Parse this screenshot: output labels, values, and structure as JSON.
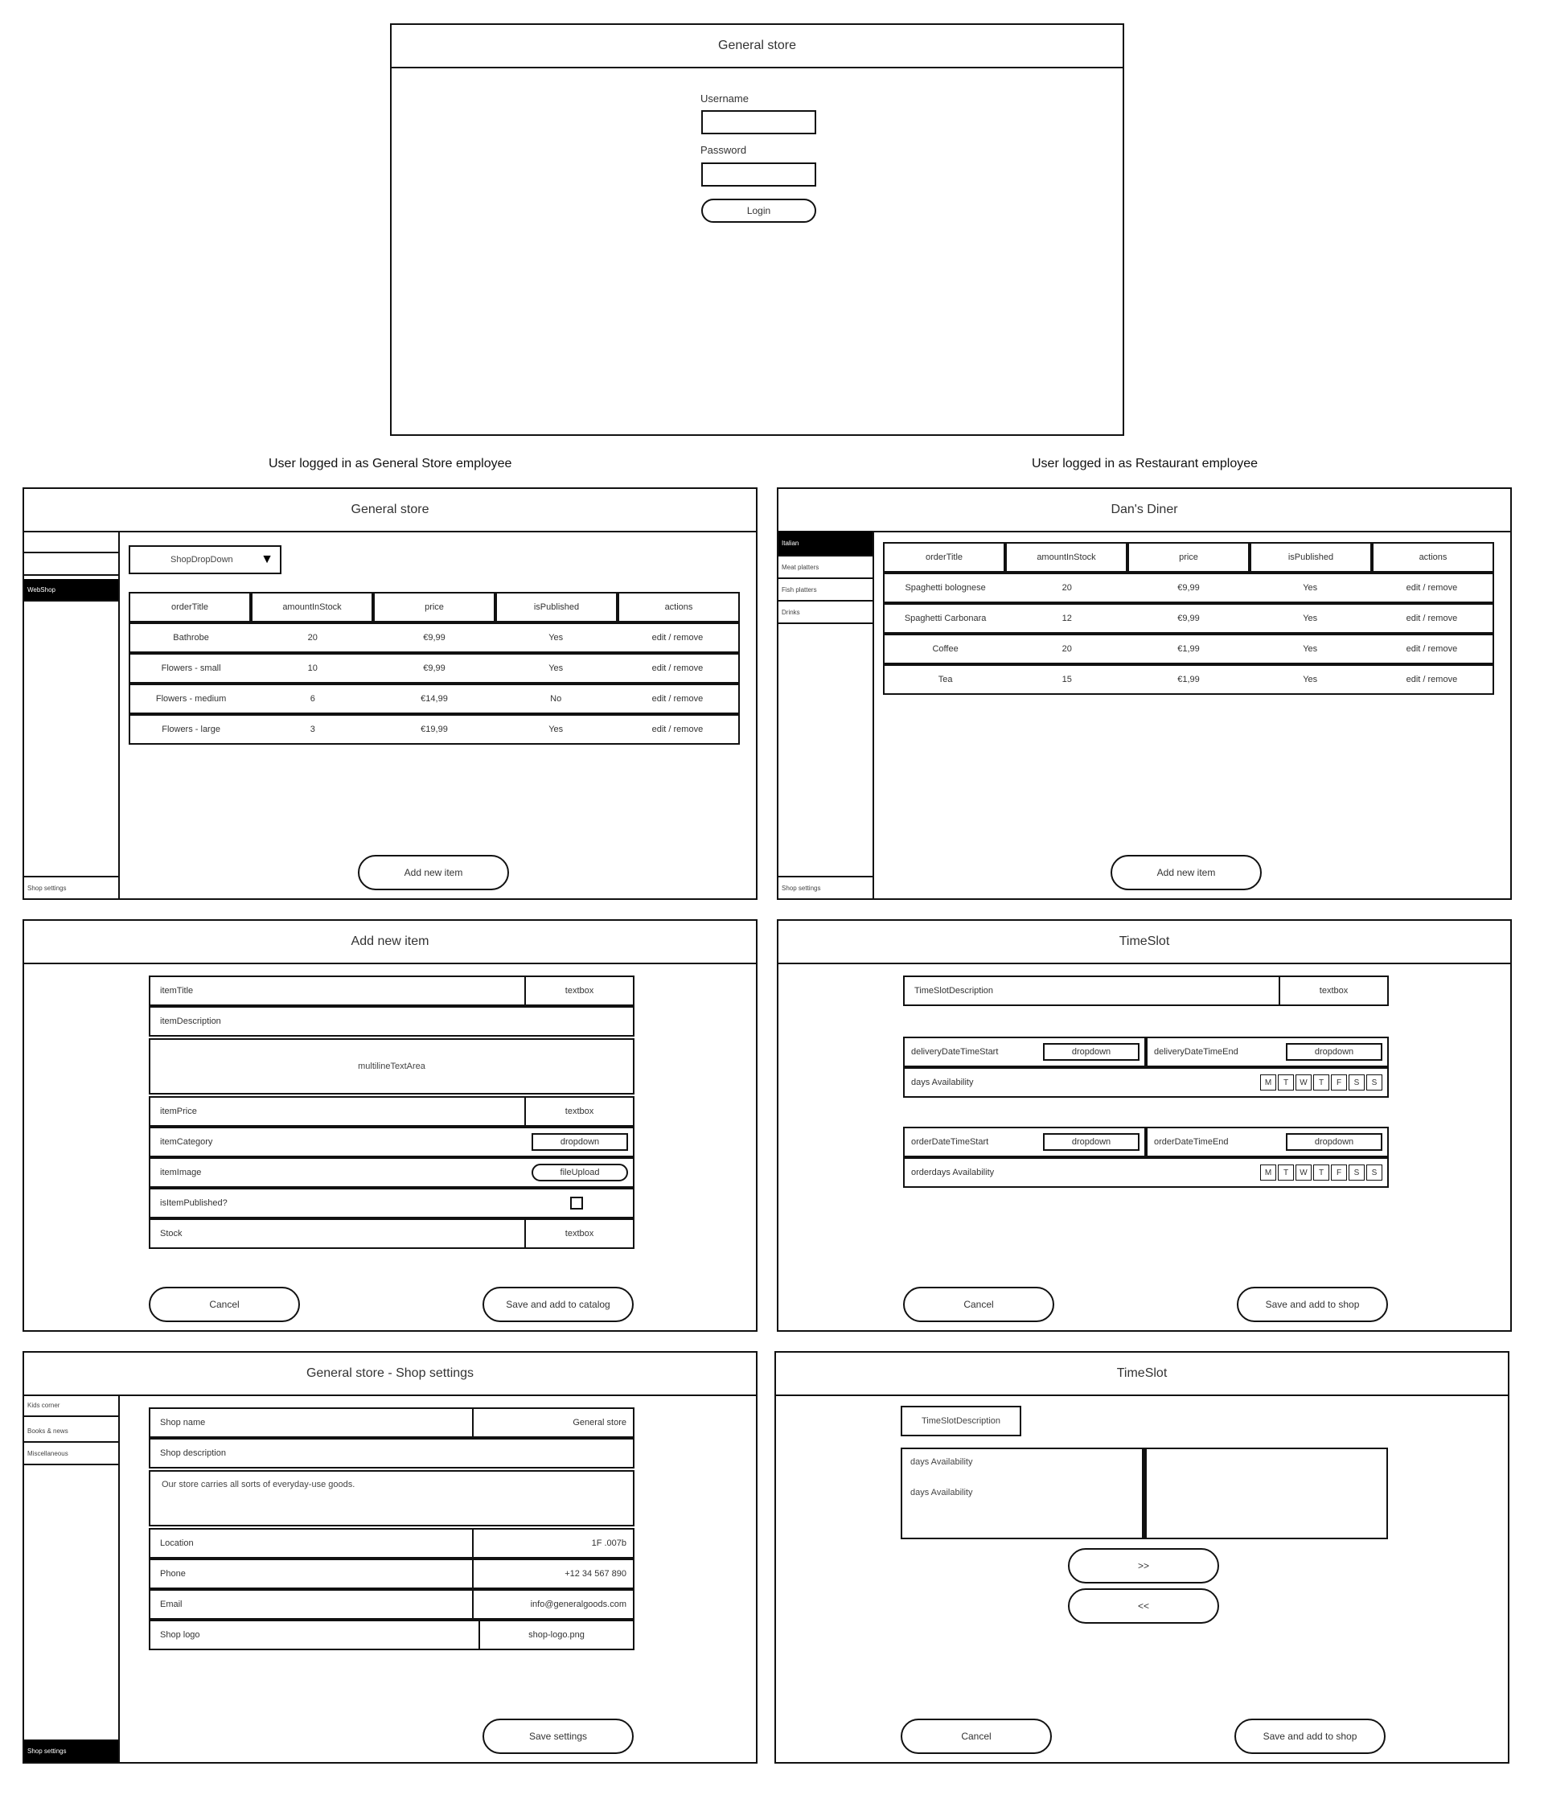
{
  "login": {
    "title": "General store",
    "username_label": "Username",
    "password_label": "Password",
    "login_button": "Login"
  },
  "captions": {
    "left": "User logged in as General Store employee",
    "right": "User logged in as Restaurant employee"
  },
  "store": {
    "title": "General store",
    "sidebar": {
      "active": "WebShop",
      "bottom": "Shop settings"
    },
    "dropdown": "ShopDropDown",
    "dropdown_arrow": "▼",
    "columns": [
      "orderTitle",
      "amountInStock",
      "price",
      "isPublished",
      "actions"
    ],
    "rows": [
      [
        "Bathrobe",
        "20",
        "€9,99",
        "Yes",
        "edit / remove"
      ],
      [
        "Flowers - small",
        "10",
        "€9,99",
        "Yes",
        "edit / remove"
      ],
      [
        "Flowers - medium",
        "6",
        "€14,99",
        "No",
        "edit / remove"
      ],
      [
        "Flowers - large",
        "3",
        "€19,99",
        "Yes",
        "edit / remove"
      ]
    ],
    "add_button": "Add new item"
  },
  "diner": {
    "title": "Dan's Diner",
    "sidebar": {
      "items": [
        "Italian",
        "Meat platters",
        "Fish platters",
        "Drinks"
      ],
      "bottom": "Shop settings"
    },
    "columns": [
      "orderTitle",
      "amountInStock",
      "price",
      "isPublished",
      "actions"
    ],
    "rows": [
      [
        "Spaghetti bolognese",
        "20",
        "€9,99",
        "Yes",
        "edit / remove"
      ],
      [
        "Spaghetti Carbonara",
        "12",
        "€9,99",
        "Yes",
        "edit / remove"
      ],
      [
        "Coffee",
        "20",
        "€1,99",
        "Yes",
        "edit / remove"
      ],
      [
        "Tea",
        "15",
        "€1,99",
        "Yes",
        "edit / remove"
      ]
    ],
    "add_button": "Add new item"
  },
  "add_item": {
    "title": "Add new item",
    "item_title": "itemTitle",
    "item_title_ctrl": "textbox",
    "item_description": "itemDescription",
    "multiline": "multilineTextArea",
    "item_price": "itemPrice",
    "item_price_ctrl": "textbox",
    "item_category": "itemCategory",
    "item_category_ctrl": "dropdown",
    "item_image": "itemImage",
    "item_image_ctrl": "fileUpload",
    "is_published": "isItemPublished?",
    "stock": "Stock",
    "stock_ctrl": "textbox",
    "cancel": "Cancel",
    "save": "Save and add to catalog"
  },
  "timeslot1": {
    "title": "TimeSlot",
    "desc": "TimeSlotDescription",
    "desc_ctrl": "textbox",
    "delivery_start": "deliveryDateTimeStart",
    "delivery_end": "deliveryDateTimeEnd",
    "dropdown": "dropdown",
    "days_availability": "days Availability",
    "order_start": "orderDateTimeStart",
    "order_end": "orderDateTimeEnd",
    "orderdays_availability": "orderdays Availability",
    "days": [
      "M",
      "T",
      "W",
      "T",
      "F",
      "S",
      "S"
    ],
    "cancel": "Cancel",
    "save": "Save and add to shop"
  },
  "settings": {
    "title": "General store - Shop settings",
    "sidebar": {
      "items": [
        "Kids corner",
        "Books & news",
        "Miscellaneous"
      ],
      "bottom": "Shop settings"
    },
    "shop_name_label": "Shop name",
    "shop_name": "General store",
    "shop_description_label": "Shop description",
    "shop_description": "Our store carries all sorts of everyday-use goods.",
    "location_label": "Location",
    "location": "1F .007b",
    "phone_label": "Phone",
    "phone": "+12 34 567 890",
    "email_label": "Email",
    "email": "info@generalgoods.com",
    "logo_label": "Shop logo",
    "logo": "shop-logo.png",
    "save": "Save settings"
  },
  "timeslot2": {
    "title": "TimeSlot",
    "desc": "TimeSlotDescription",
    "days_availability_1": "days Availability",
    "days_availability_2": "days Availability",
    "move_right": ">>",
    "move_left": "<<",
    "cancel": "Cancel",
    "save": "Save and add to shop"
  }
}
